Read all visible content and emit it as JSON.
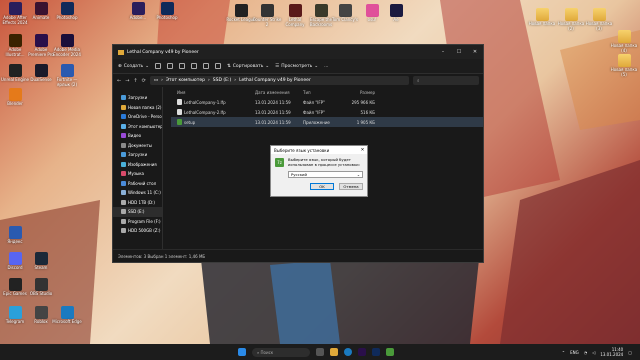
{
  "desktop": {
    "left_icons": [
      {
        "label": "Adobe After Effects 2024",
        "color": "#2a1e5c"
      },
      {
        "label": "Animate",
        "color": "#3a1230"
      },
      {
        "label": "Photoshop",
        "color": "#0f2a5a"
      },
      {
        "label": "Adobe Illustrat...",
        "color": "#3a2200"
      },
      {
        "label": "Adobe Premiere Pro",
        "color": "#2a0f4a"
      },
      {
        "label": "Adobe Media Encoder 2024",
        "color": "#1a0f3a"
      },
      {
        "label": "Unreal Engine",
        "color": "#222222"
      },
      {
        "label": "DualSense",
        "color": "#1a1a2a"
      },
      {
        "label": "Fortnite — ярлык (2)",
        "color": "#2a5ab0"
      },
      {
        "label": "Blender",
        "color": "#e57a1a"
      }
    ],
    "top_icons": [
      {
        "label": "Adobe...",
        "color": "#2a1e5c"
      },
      {
        "label": "Photoshop",
        "color": "#0f2a5a"
      },
      {
        "label": "Rocket League",
        "color": "#222222"
      },
      {
        "label": "Counter Strike 2",
        "color": "#333333"
      },
      {
        "label": "Lethal Company",
        "color": "#5a1a1a"
      },
      {
        "label": "Escape the Backrooms",
        "color": "#3a3a2a"
      },
      {
        "label": "Tom Clancy's",
        "color": "#444444"
      },
      {
        "label": "osu!",
        "color": "#e0509a"
      },
      {
        "label": "Ae",
        "color": "#1a1a40"
      }
    ],
    "right_icons": [
      {
        "label": "Новая папка",
        "folder": true
      },
      {
        "label": "Новая папка (2)",
        "folder": true
      },
      {
        "label": "Новая папка (3)",
        "folder": true
      },
      {
        "label": "Новая папка (4)",
        "folder": true
      },
      {
        "label": "Новая папка (5)",
        "folder": true
      }
    ],
    "bottom_icons": [
      {
        "label": "Яндекс",
        "color": "#2a5ab0"
      },
      {
        "label": "Discord",
        "color": "#5865f2"
      },
      {
        "label": "Steam",
        "color": "#1b2838"
      },
      {
        "label": "Epic Games",
        "color": "#222222"
      },
      {
        "label": "OBS Studio",
        "color": "#333333"
      },
      {
        "label": "Telegram",
        "color": "#2aa0da"
      },
      {
        "label": "Roblox",
        "color": "#444444"
      },
      {
        "label": "Microsoft Edge",
        "color": "#1a7ac0"
      }
    ]
  },
  "explorer": {
    "title": "Lethal Company v49 by Pioneer",
    "toolbar": {
      "create": "Создать",
      "sort": "Сортировать",
      "view": "Просмотреть",
      "more": "..."
    },
    "address": [
      "Этот компьютер",
      "SSD (E:)",
      "Lethal Company v49 by Pioneer"
    ],
    "nav_pane": [
      {
        "label": "Загрузки",
        "color": "#4a9ad8"
      },
      {
        "label": "Новая папка (2)",
        "color": "#e0a93a"
      },
      {
        "label": "OneDrive - Perso",
        "color": "#2a7ad8"
      },
      {
        "label": "Этот компьютер",
        "color": "#5ab0e8"
      },
      {
        "label": "Видео",
        "color": "#9a4ad8"
      },
      {
        "label": "Документы",
        "color": "#8a8a8a"
      },
      {
        "label": "Загрузки",
        "color": "#4a9ad8"
      },
      {
        "label": "Изображения",
        "color": "#4ab0d8"
      },
      {
        "label": "Музыка",
        "color": "#d84a6a"
      },
      {
        "label": "Рабочий стол",
        "color": "#4a8ad8"
      },
      {
        "label": "Windows 11 (C:)",
        "color": "#8ab0d8"
      },
      {
        "label": "HDD 1TB (D:)",
        "color": "#aaaaaa"
      },
      {
        "label": "SSD (E:)",
        "color": "#aaaaaa"
      },
      {
        "label": "Program File (F:)",
        "color": "#aaaaaa"
      },
      {
        "label": "HDD 500GB (Z:)",
        "color": "#aaaaaa"
      }
    ],
    "columns": {
      "name": "Имя",
      "date": "Дата изменения",
      "type": "Тип",
      "size": "Размер"
    },
    "files": [
      {
        "name": "LethalCompany-1.Ifp",
        "date": "13.01.2024 11:59",
        "type": "Файл \"IFP\"",
        "size": "295 966 КБ"
      },
      {
        "name": "LethalCompany-2.Ifp",
        "date": "13.01.2024 11:59",
        "type": "Файл \"IFP\"",
        "size": "516 КБ"
      },
      {
        "name": "setup",
        "date": "13.01.2024 11:59",
        "type": "Приложение",
        "size": "1 905 КБ"
      }
    ],
    "status": "Элементов: 3    Выбран 1 элемент: 1,46 МБ"
  },
  "dialog": {
    "title": "Выберите язык установки",
    "message": "Выберите язык, который будет использован в процессе установки:",
    "language": "Русский",
    "ok": "OK",
    "cancel": "Отмена"
  },
  "taskbar": {
    "search_placeholder": "Поиск",
    "lang": "ENG",
    "time": "11:40",
    "date": "13.01.2024"
  }
}
